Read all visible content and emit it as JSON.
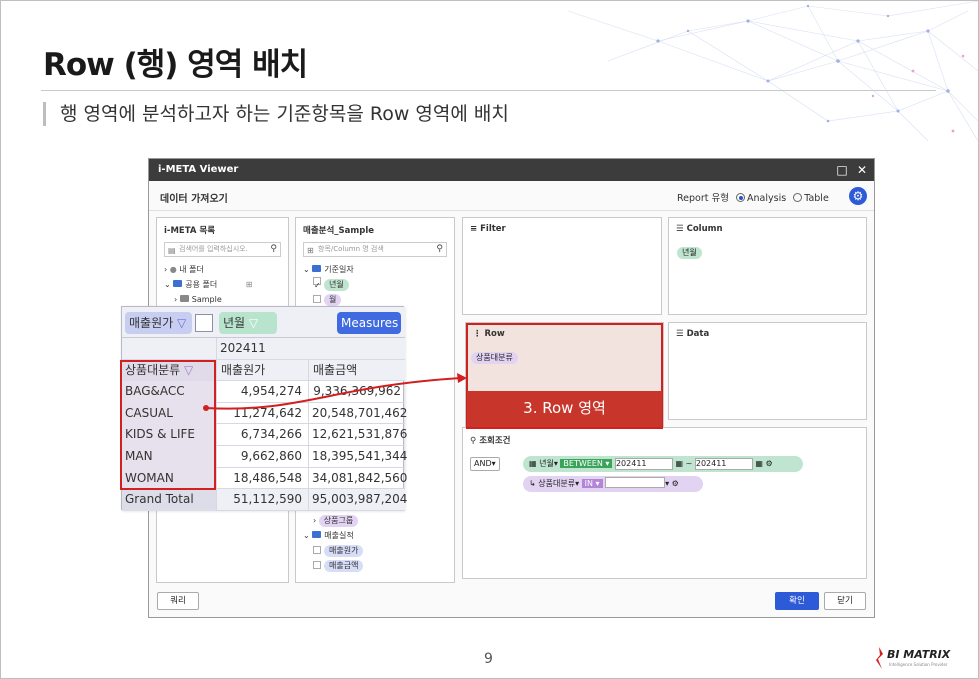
{
  "slide": {
    "title": "Row (행) 영역 배치",
    "subtitle": "행 영역에 분석하고자 하는 기준항목을 Row 영역에 배치",
    "page_number": "9",
    "logo_text": "BI MATRIX",
    "logo_sub": "Intelligence Solution Provider"
  },
  "viewer": {
    "title": "i-META Viewer",
    "toolbar_label": "데이터 가져오기",
    "report_type_label": "Report 유형",
    "report_options": [
      "Analysis",
      "Table"
    ],
    "selected_report": "Analysis",
    "meta_panel": {
      "title": "i-META 목록",
      "search_placeholder": "검색어를 입력하십시오.",
      "tree": [
        "내 폴더",
        "공용 폴더",
        "Sample"
      ]
    },
    "sample_panel": {
      "title": "매출분석_Sample",
      "search_placeholder": "항목/Column 명 검색",
      "tree": [
        "기준일자",
        "년월",
        "월",
        "상품그룹",
        "매출실적",
        "매출원가",
        "매출금액"
      ]
    },
    "filter_title": "Filter",
    "column_title": "Column",
    "column_item": "년월",
    "row_title": "Row",
    "row_item": "상품대분류",
    "data_title": "Data",
    "condition": {
      "title": "조회조건",
      "logic": "AND",
      "row1_field": "년월",
      "row1_op": "BETWEEN",
      "row1_from": "202411",
      "row1_sep": "~",
      "row1_to": "202411",
      "row2_field": "상품대분류",
      "row2_op": "IN",
      "row2_value": ""
    },
    "query_button": "쿼리",
    "ok_button": "확인",
    "close_button": "닫기"
  },
  "pivot": {
    "chip_a": "매출원가",
    "chip_c": "년월",
    "chip_b": "Measures",
    "period": "202411",
    "row_header": "상품대분류",
    "col1_header": "매출원가",
    "col2_header": "매출금액",
    "rows": [
      {
        "name": "BAG&ACC",
        "cost": "4,954,274",
        "sales": "9,336,369,962"
      },
      {
        "name": "CASUAL",
        "cost": "11,274,642",
        "sales": "20,548,701,462"
      },
      {
        "name": "KIDS & LIFE",
        "cost": "6,734,266",
        "sales": "12,621,531,876"
      },
      {
        "name": "MAN",
        "cost": "9,662,860",
        "sales": "18,395,541,344"
      },
      {
        "name": "WOMAN",
        "cost": "18,486,548",
        "sales": "34,081,842,560"
      }
    ],
    "total": {
      "name": "Grand Total",
      "cost": "51,112,590",
      "sales": "95,003,987,204"
    }
  },
  "callout": "3. Row 영역",
  "colors": {
    "accent": "#2d5bd8",
    "highlight": "#d21f1f",
    "callout_bg": "#c8362b",
    "row_panel_bg": "#f3e3de"
  }
}
